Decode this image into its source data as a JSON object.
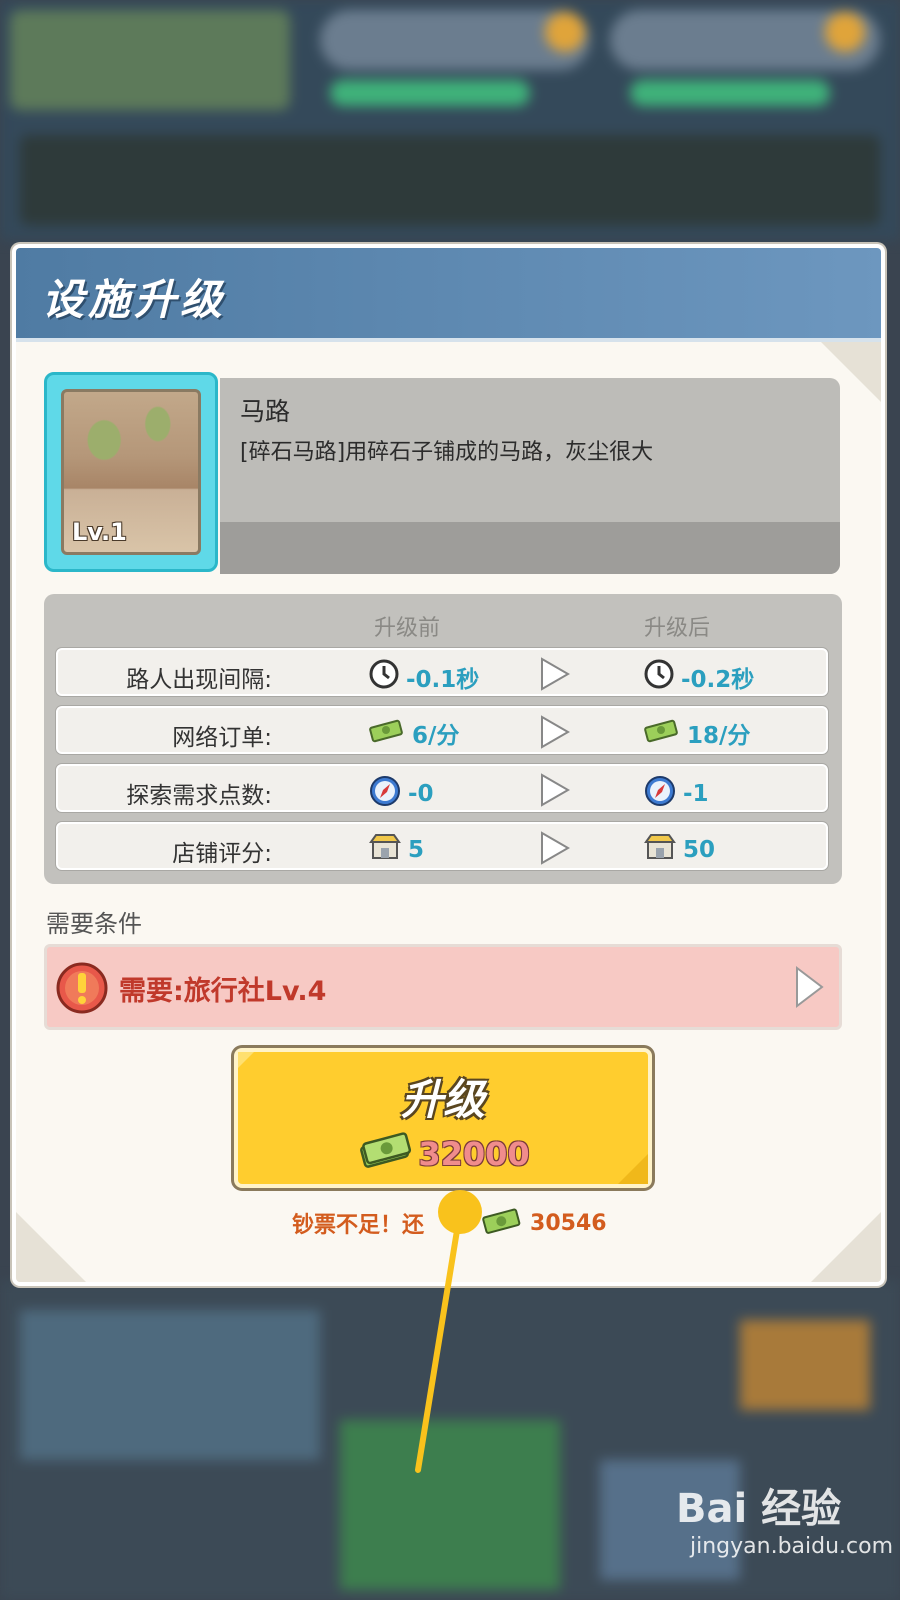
{
  "dialog": {
    "title": "设施升级"
  },
  "facility": {
    "name": "马路",
    "description": "[碎石马路]用碎石子铺成的马路，灰尘很大",
    "level": "Lv.1"
  },
  "stats": {
    "header_before": "升级前",
    "header_after": "升级后",
    "rows": [
      {
        "label": "路人出现间隔:",
        "icon": "clock-icon",
        "before": "-0.1秒",
        "after": "-0.2秒"
      },
      {
        "label": "网络订单:",
        "icon": "money-icon",
        "before": "6/分",
        "after": "18/分"
      },
      {
        "label": "探索需求点数:",
        "icon": "compass-icon",
        "before": "-0",
        "after": "-1"
      },
      {
        "label": "店铺评分:",
        "icon": "shop-icon",
        "before": "5",
        "after": "50"
      }
    ]
  },
  "requirements": {
    "title": "需要条件",
    "item": "需要:旅行社Lv.4"
  },
  "upgrade": {
    "label": "升级",
    "cost": "32000",
    "shortage_text": "钞票不足！还",
    "shortage_amount": "30546"
  },
  "watermark": {
    "logo": "Bai  经验",
    "url": "jingyan.baidu.com"
  },
  "colors": {
    "header": "#5a85ad",
    "button": "#ffcd2e",
    "accent_text": "#2b9fbf",
    "warning_text": "#c0392b",
    "pointer": "#f9c21c"
  }
}
